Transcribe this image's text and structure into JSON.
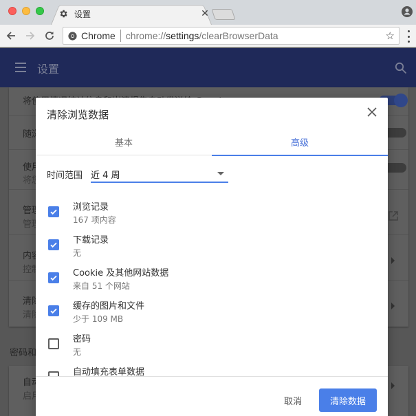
{
  "browser": {
    "tab": {
      "title": "设置",
      "icon": "gear-icon"
    },
    "omnibox": {
      "chip": "Chrome",
      "url_prefix": "chrome://",
      "url_host": "settings",
      "url_path": "/clearBrowserData"
    }
  },
  "appbar": {
    "title": "设置"
  },
  "settings": {
    "rows": [
      {
        "title": "将使用情况统计信息和崩溃报告自动发送给 Google",
        "sub": "",
        "control": "toggle-on"
      },
      {
        "title": "随浏览流量一起发送“请勿跟踪”请求",
        "sub": "",
        "control": "toggle-off"
      },
      {
        "title": "使用",
        "sub": "将您",
        "control": "toggle-off"
      },
      {
        "title": "管理",
        "sub": "管理",
        "control": "external-link"
      },
      {
        "title": "内容",
        "sub": "控制",
        "control": "arrow"
      },
      {
        "title": "清除",
        "sub": "清除",
        "control": "arrow"
      }
    ],
    "section2_title": "密码和表单",
    "section2_rows": [
      {
        "title": "自动",
        "sub": "启用",
        "control": "arrow"
      }
    ]
  },
  "dialog": {
    "title": "清除浏览数据",
    "tabs": [
      {
        "label": "基本",
        "selected": false
      },
      {
        "label": "高级",
        "selected": true
      }
    ],
    "time_range": {
      "label": "时间范围",
      "value": "近 4 周"
    },
    "items": [
      {
        "title": "浏览记录",
        "sub": "167 项内容",
        "checked": true
      },
      {
        "title": "下载记录",
        "sub": "无",
        "checked": true
      },
      {
        "title": "Cookie 及其他网站数据",
        "sub": "来自 51 个网站",
        "checked": true
      },
      {
        "title": "缓存的图片和文件",
        "sub": "少于 109 MB",
        "checked": true
      },
      {
        "title": "密码",
        "sub": "无",
        "checked": false
      },
      {
        "title": "自动填充表单数据",
        "sub": "",
        "checked": false
      }
    ],
    "cancel_label": "取消",
    "confirm_label": "清除数据"
  },
  "colors": {
    "accent": "#4a7fe8",
    "appbar": "#1f2959"
  }
}
